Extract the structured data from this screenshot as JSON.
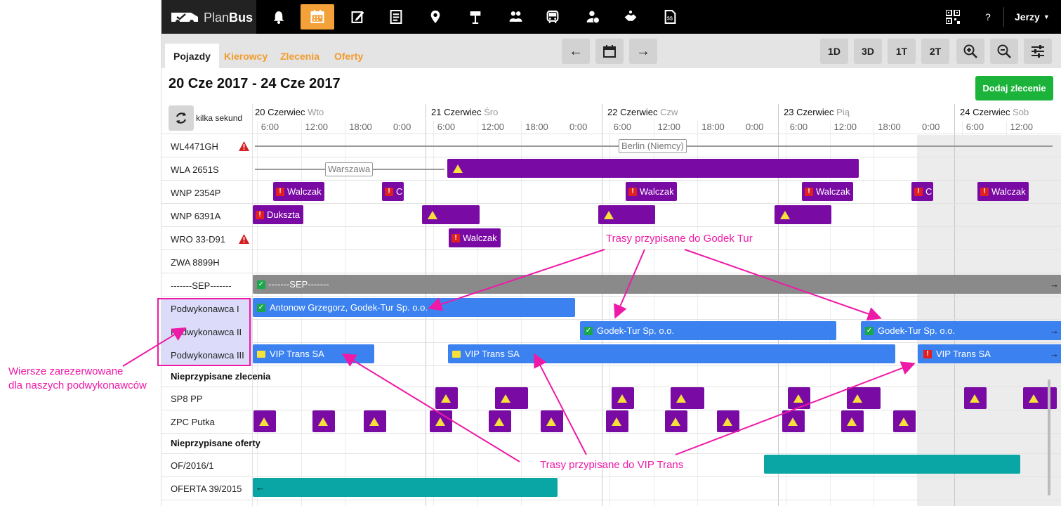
{
  "app": {
    "logo_light": "Plan",
    "logo_bold": "Bus",
    "user": "Jerzy",
    "help": "?"
  },
  "toolbar": {
    "icons": [
      "bell-icon",
      "calendar-icon",
      "edit-icon",
      "document-icon",
      "map-pin-icon",
      "signpost-icon",
      "people-icon",
      "bus-icon",
      "driver-icon",
      "handshake-icon",
      "invoice-icon"
    ]
  },
  "tabs": [
    "Pojazdy",
    "Kierowcy",
    "Zlecenia",
    "Oferty"
  ],
  "zoom_buttons": [
    "1D",
    "3D",
    "1T",
    "2T"
  ],
  "header": {
    "date_range": "20 Cze 2017 - 24 Cze 2017",
    "add_button": "Dodaj zlecenie",
    "refresh_label": "kilka sekund"
  },
  "days": [
    {
      "name": "20 Czerwiec",
      "weekday": "Wto"
    },
    {
      "name": "21 Czerwiec",
      "weekday": "Śro"
    },
    {
      "name": "22 Czerwiec",
      "weekday": "Czw"
    },
    {
      "name": "23 Czerwiec",
      "weekday": "Pią"
    },
    {
      "name": "24 Czerwiec",
      "weekday": "Sob"
    }
  ],
  "hours": [
    "6:00",
    "12:00",
    "18:00",
    "0:00",
    "6:00",
    "12:00",
    "18:00",
    "0:00",
    "6:00",
    "12:00",
    "18:00",
    "0:00",
    "6:00",
    "12:00",
    "18:00",
    "0:00",
    "6:00",
    "12:00"
  ],
  "rows": [
    "WL4471GH",
    "WLA 2651S",
    "WNP 2354P",
    "WNP 6391A",
    "WRO 33-D91",
    "ZWA 8899H",
    "-------SEP-------",
    "Podwykonawca I",
    "Podwykonawca II",
    "Podwykonawca III"
  ],
  "sections": {
    "unassigned_orders": "Nieprzypisane zlecenia",
    "unassigned_offers": "Nieprzypisane oferty"
  },
  "unassigned_rows": [
    "SP8 PP",
    "ZPC Putka"
  ],
  "offer_rows": [
    "OF/2016/1",
    "OFERTA 39/2015"
  ],
  "bar_texts": {
    "berlin": "Berlin (Niemcy)",
    "warszawa": "Warszawa",
    "walczak": "Walczak",
    "walczak_short": "C",
    "dukszta": "Dukszta",
    "sep": "-------SEP-------",
    "antonow": "Antonow Grzegorz, Godek-Tur Sp. o.o.",
    "godek": "Godek-Tur Sp. o.o.",
    "vip": "VIP Trans SA"
  },
  "annotations": {
    "godek": "Trasy przypisane do Godek Tur",
    "vip": "Trasy przypisane do VIP Trans",
    "reserved_line1": "Wiersze zarezerwowane",
    "reserved_line2": "dla naszych podwykonawców"
  },
  "colors": {
    "accent": "#f4a13a",
    "purple": "#7a0aa4",
    "blue": "#3b82f0",
    "teal": "#0aa5a5",
    "green": "#1bb33a",
    "annotation": "#ee1aa7"
  }
}
